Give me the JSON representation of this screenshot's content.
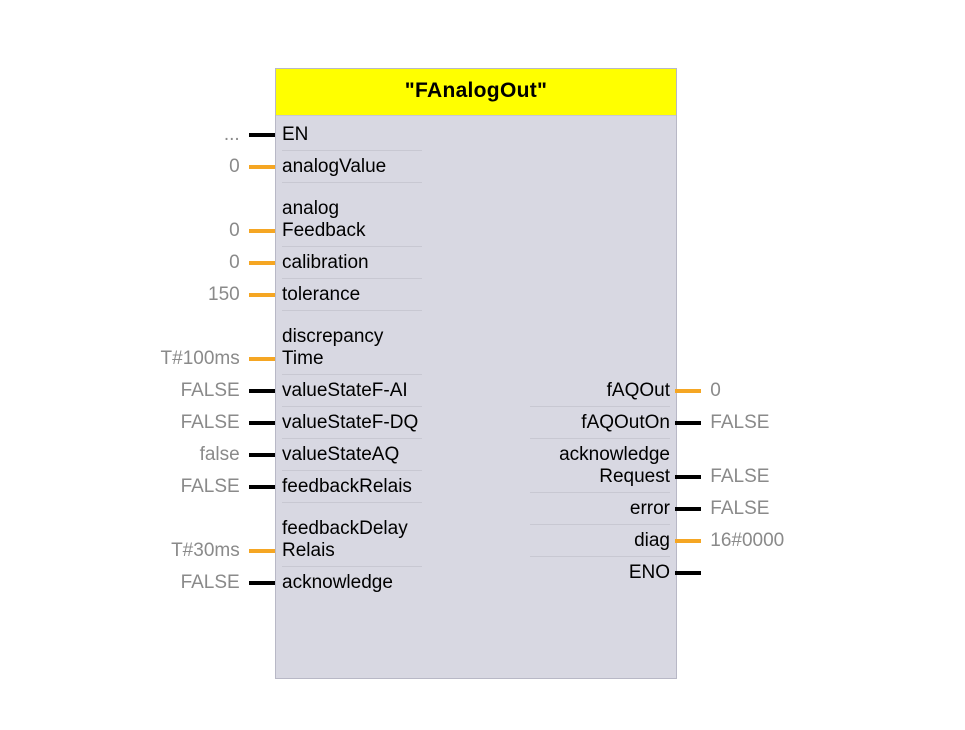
{
  "block": {
    "title": "\"FAnalogOut\"",
    "inputs": [
      {
        "label": "EN",
        "value": "...",
        "color": "black"
      },
      {
        "label": "analogValue",
        "value": "0",
        "color": "orange"
      },
      {
        "label": "analog\nFeedback",
        "value": "0",
        "color": "orange"
      },
      {
        "label": "calibration",
        "value": "0",
        "color": "orange"
      },
      {
        "label": "tolerance",
        "value": "150",
        "color": "orange"
      },
      {
        "label": "discrepancy\nTime",
        "value": "T#100ms",
        "color": "orange"
      },
      {
        "label": "valueStateF-AI",
        "value": "FALSE",
        "color": "black"
      },
      {
        "label": "valueStateF-DQ",
        "value": "FALSE",
        "color": "black"
      },
      {
        "label": "valueStateAQ",
        "value": "false",
        "color": "black"
      },
      {
        "label": "feedbackRelais",
        "value": "FALSE",
        "color": "black"
      },
      {
        "label": "feedbackDelay\nRelais",
        "value": "T#30ms",
        "color": "orange"
      },
      {
        "label": "acknowledge",
        "value": "FALSE",
        "color": "black"
      }
    ],
    "outputs": [
      {
        "label": "fAQOut",
        "value": "0",
        "color": "orange"
      },
      {
        "label": "fAQOutOn",
        "value": "FALSE",
        "color": "black"
      },
      {
        "label": "acknowledge\nRequest",
        "value": "FALSE",
        "color": "black"
      },
      {
        "label": "error",
        "value": "FALSE",
        "color": "black"
      },
      {
        "label": "diag",
        "value": "16#0000",
        "color": "orange"
      },
      {
        "label": "ENO",
        "value": "",
        "color": "black"
      }
    ]
  },
  "chart_data": {
    "type": "table",
    "title": "FAnalogOut function block pin diagram",
    "inputs": [
      {
        "name": "EN",
        "value": "..."
      },
      {
        "name": "analogValue",
        "value": 0
      },
      {
        "name": "analogFeedback",
        "value": 0
      },
      {
        "name": "calibration",
        "value": 0
      },
      {
        "name": "tolerance",
        "value": 150
      },
      {
        "name": "discrepancyTime",
        "value": "T#100ms"
      },
      {
        "name": "valueStateF-AI",
        "value": "FALSE"
      },
      {
        "name": "valueStateF-DQ",
        "value": "FALSE"
      },
      {
        "name": "valueStateAQ",
        "value": "false"
      },
      {
        "name": "feedbackRelais",
        "value": "FALSE"
      },
      {
        "name": "feedbackDelayRelais",
        "value": "T#30ms"
      },
      {
        "name": "acknowledge",
        "value": "FALSE"
      }
    ],
    "outputs": [
      {
        "name": "fAQOut",
        "value": 0
      },
      {
        "name": "fAQOutOn",
        "value": "FALSE"
      },
      {
        "name": "acknowledgeRequest",
        "value": "FALSE"
      },
      {
        "name": "error",
        "value": "FALSE"
      },
      {
        "name": "diag",
        "value": "16#0000"
      },
      {
        "name": "ENO",
        "value": ""
      }
    ]
  }
}
